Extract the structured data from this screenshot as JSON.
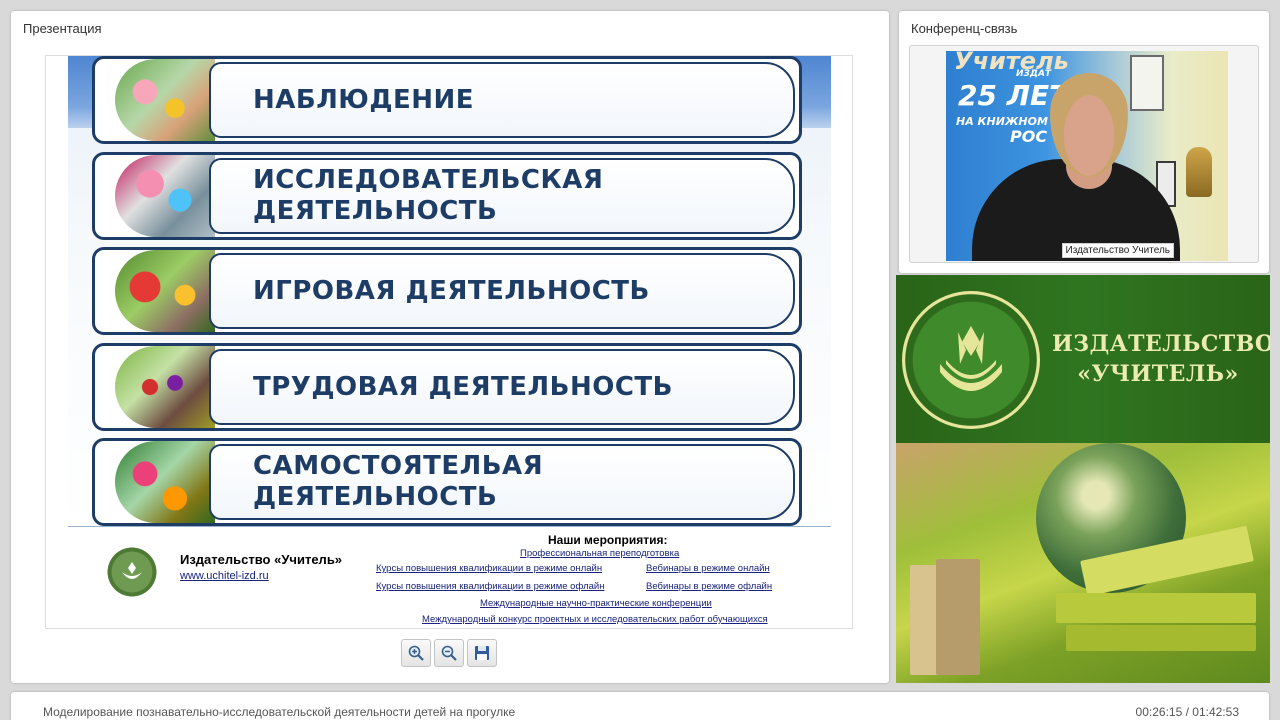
{
  "presentation": {
    "title": "Презентация",
    "slide": {
      "activities": [
        {
          "label": "НАБЛЮДЕНИЕ"
        },
        {
          "label": "ИССЛЕДОВАТЕЛЬСКАЯ ДЕЯТЕЛЬНОСТЬ"
        },
        {
          "label": "ИГРОВАЯ ДЕЯТЕЛЬНОСТЬ"
        },
        {
          "label": "ТРУДОВАЯ ДЕЯТЕЛЬНОСТЬ"
        },
        {
          "label": "САМОСТОЯТЕЛЬАЯ ДЕЯТЕЛЬНОСТЬ"
        }
      ],
      "footer": {
        "publisher_name": "Издательство «Учитель»",
        "publisher_url": "www.uchitel-izd.ru",
        "events_title": "Наши мероприятия:",
        "events": [
          "Профессиональная переподготовка",
          "Курсы повышения квалификации в режиме онлайн",
          "Вебинары в режиме онлайн",
          "Курсы повышения квалификации в режиме офлайн",
          "Вебинары в режиме офлайн",
          "Международные научно-практические конференции",
          "Международный конкурс проектных и исследовательских работ обучающихся"
        ]
      }
    },
    "toolbar": {
      "zoom_in_icon": "zoom-in-icon",
      "zoom_out_icon": "zoom-out-icon",
      "save_icon": "floppy-disk-icon"
    }
  },
  "conference": {
    "title": "Конференц-связь",
    "video": {
      "speaker_name": "Издательство Учитель",
      "poster_line1": "Учитель",
      "poster_line2": "ИЗДАТ",
      "poster_line3": "25 ЛЕТ",
      "poster_line4": "НА КНИЖНОМ Р",
      "poster_line5": "РОС"
    }
  },
  "brand": {
    "line1": "ИЗДАТЕЛЬСТВО",
    "line2": "«УЧИТЕЛЬ»"
  },
  "bottom_bar": {
    "webinar_title": "Моделирование познавательно-исследовательской деятельности детей на прогулке",
    "time_elapsed": "00:26:15",
    "time_separator": " / ",
    "time_total": "01:42:53"
  }
}
